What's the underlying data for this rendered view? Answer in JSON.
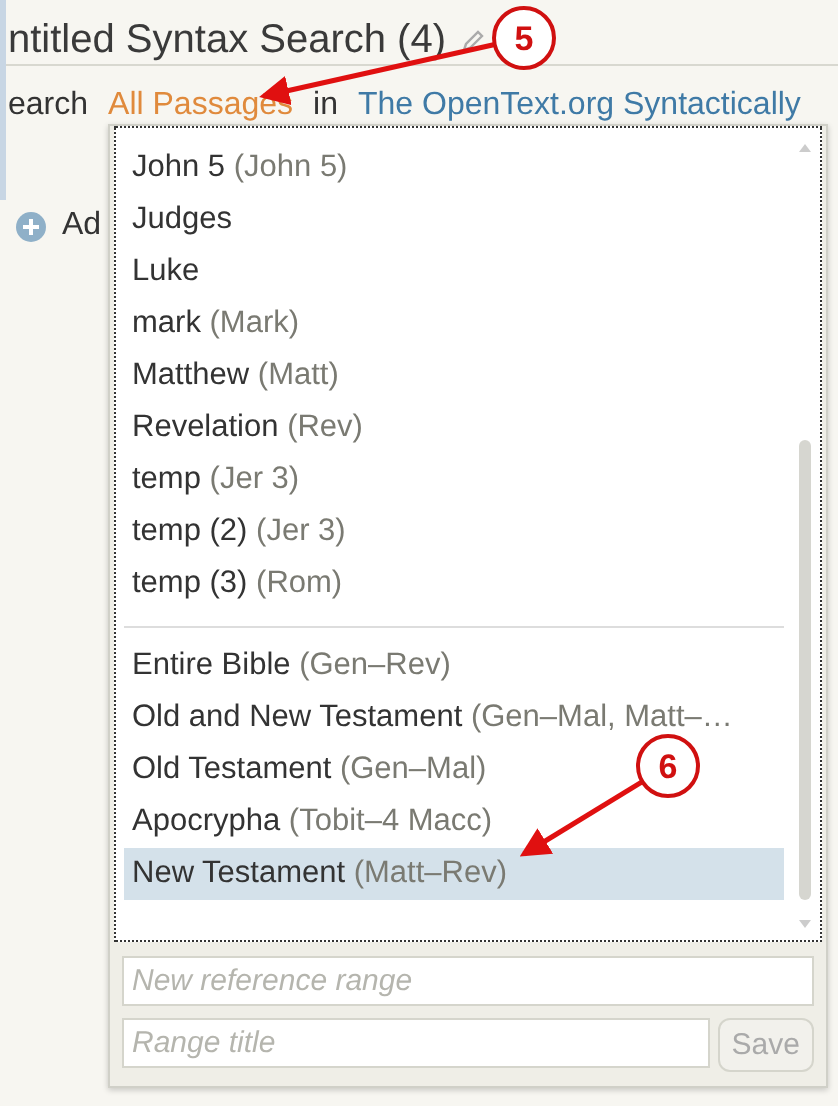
{
  "title": "ntitled Syntax Search (4)",
  "search_line": {
    "prefix": "earch",
    "passages": "All Passages",
    "joiner": "in",
    "database": "The OpenText.org Syntactically"
  },
  "add_row": {
    "label": "Ad"
  },
  "dropdown": {
    "groups": [
      {
        "items": [
          {
            "label": "John 5",
            "range": "(John 5)",
            "selected": false
          },
          {
            "label": "Judges",
            "selected": false
          },
          {
            "label": "Luke",
            "selected": false
          },
          {
            "label": "mark",
            "range": "(Mark)",
            "selected": false
          },
          {
            "label": "Matthew",
            "range": "(Matt)",
            "selected": false
          },
          {
            "label": "Revelation",
            "range": "(Rev)",
            "selected": false
          },
          {
            "label": "temp",
            "range": "(Jer 3)",
            "selected": false
          },
          {
            "label": "temp (2)",
            "range": "(Jer 3)",
            "selected": false
          },
          {
            "label": "temp (3)",
            "range": "(Rom)",
            "selected": false
          }
        ]
      },
      {
        "items": [
          {
            "label": "Entire Bible",
            "range": "(Gen–Rev)",
            "selected": false
          },
          {
            "label": "Old and New Testament",
            "range": "(Gen–Mal, Matt–…",
            "selected": false
          },
          {
            "label": "Old Testament",
            "range": "(Gen–Mal)",
            "selected": false
          },
          {
            "label": "Apocrypha",
            "range": "(Tobit–4 Macc)",
            "selected": false
          },
          {
            "label": "New Testament",
            "range": "(Matt–Rev)",
            "selected": true
          }
        ]
      }
    ],
    "range_field": {
      "placeholder": "New reference range"
    },
    "title_field": {
      "placeholder": "Range title"
    },
    "save_button": {
      "label": "Save",
      "disabled": true
    }
  },
  "callouts": [
    {
      "number": "5"
    },
    {
      "number": "6"
    }
  ]
}
